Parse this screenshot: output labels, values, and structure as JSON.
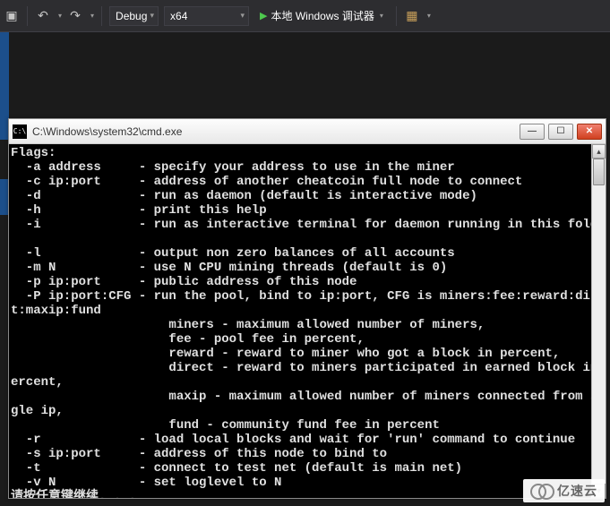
{
  "toolbar": {
    "undo_title": "撤销",
    "redo_title": "重做",
    "config_label": "Debug",
    "platform_label": "x64",
    "run_label": "本地 Windows 调试器"
  },
  "cmd": {
    "title": "C:\\Windows\\system32\\cmd.exe",
    "lines": [
      "Flags:",
      "  -a address     - specify your address to use in the miner",
      "  -c ip:port     - address of another cheatcoin full node to connect",
      "  -d             - run as daemon (default is interactive mode)",
      "  -h             - print this help",
      "  -i             - run as interactive terminal for daemon running in this folder",
      "",
      "  -l             - output non zero balances of all accounts",
      "  -m N           - use N CPU mining threads (default is 0)",
      "  -p ip:port     - public address of this node",
      "  -P ip:port:CFG - run the pool, bind to ip:port, CFG is miners:fee:reward:direc",
      "t:maxip:fund",
      "                     miners - maximum allowed number of miners,",
      "                     fee - pool fee in percent,",
      "                     reward - reward to miner who got a block in percent,",
      "                     direct - reward to miners participated in earned block in p",
      "ercent,",
      "                     maxip - maximum allowed number of miners connected from sin",
      "gle ip,",
      "                     fund - community fund fee in percent",
      "  -r             - load local blocks and wait for 'run' command to continue",
      "  -s ip:port     - address of this node to bind to",
      "  -t             - connect to test net (default is main net)",
      "  -v N           - set loglevel to N",
      "请按任意键继续. . ."
    ]
  },
  "watermark": "亿速云"
}
